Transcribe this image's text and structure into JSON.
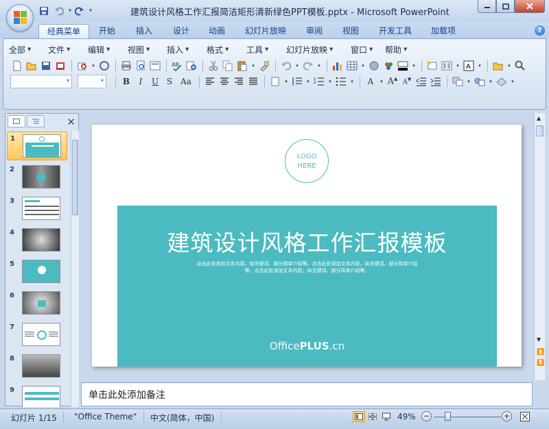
{
  "window": {
    "title": "建筑设计风格工作汇报简洁矩形清新绿色PPT模板.pptx - Microsoft PowerPoint"
  },
  "ribbon_tabs": [
    {
      "label": "经典菜单",
      "active": true
    },
    {
      "label": "开始"
    },
    {
      "label": "插入"
    },
    {
      "label": "设计"
    },
    {
      "label": "动画"
    },
    {
      "label": "幻灯片放映"
    },
    {
      "label": "审阅"
    },
    {
      "label": "视图"
    },
    {
      "label": "开发工具"
    },
    {
      "label": "加载项"
    }
  ],
  "classic_menu": [
    "全部",
    "文件",
    "编辑",
    "视图",
    "插入",
    "格式",
    "工具",
    "幻灯片放映",
    "窗口",
    "帮助"
  ],
  "slide": {
    "logo_line1": "LOGO",
    "logo_line2": "HERE",
    "title": "建筑设计风格工作汇报模板",
    "subtitle_line1": "点击此处添加文本内容，如关键词、部分简单介绍等。点击此处添加文本内容，如关键词、部分简单介绍",
    "subtitle_line2": "等。点击此处添加文本内容，如关键词、部分简单介绍等。",
    "brand_office": "Office",
    "brand_plus": "PLUS",
    "brand_cn": ".cn",
    "accent_color": "#4bbbc1"
  },
  "thumbnails": [
    {
      "number": "1",
      "selected": true
    },
    {
      "number": "2"
    },
    {
      "number": "3"
    },
    {
      "number": "4"
    },
    {
      "number": "5"
    },
    {
      "number": "6"
    },
    {
      "number": "7"
    },
    {
      "number": "8"
    },
    {
      "number": "9"
    }
  ],
  "notes": {
    "placeholder": "单击此处添加备注"
  },
  "status": {
    "slide_indicator": "幻灯片 1/15",
    "theme": "\"Office Theme\"",
    "language": "中文(简体，中国)",
    "zoom": "49%",
    "zoom_level": 49
  }
}
